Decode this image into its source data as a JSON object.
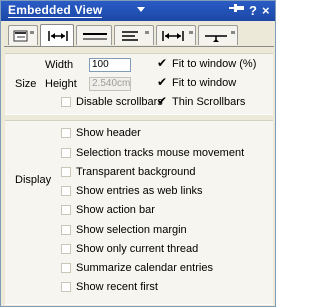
{
  "window": {
    "title": "Embedded View",
    "pin_icon": "pin-icon",
    "help_label": "?",
    "close_label": "×"
  },
  "tabs": [
    {
      "name": "basics",
      "icon": "properties-icon"
    },
    {
      "name": "width",
      "icon": "width-arrows-icon",
      "selected": true
    },
    {
      "name": "border",
      "icon": "border-lines-icon"
    },
    {
      "name": "text",
      "icon": "paragraph-icon"
    },
    {
      "name": "size",
      "icon": "stretch-icon"
    },
    {
      "name": "margin",
      "icon": "margin-icon"
    }
  ],
  "size_section": {
    "label": "Size",
    "width_label": "Width",
    "width_value": "100",
    "height_label": "Height",
    "height_value": "2.540cm",
    "options": [
      {
        "label": "Fit to window (%)",
        "checked": true
      },
      {
        "label": "Fit to window",
        "checked": true
      },
      {
        "label": "Disable scrollbars",
        "checked": false
      },
      {
        "label": "Thin Scrollbars",
        "checked": true
      }
    ]
  },
  "display_section": {
    "label": "Display",
    "options": [
      {
        "label": "Show header",
        "checked": false
      },
      {
        "label": "Selection tracks mouse movement",
        "checked": false
      },
      {
        "label": "Transparent background",
        "checked": false
      },
      {
        "label": "Show entries as web links",
        "checked": false
      },
      {
        "label": "Show action bar",
        "checked": false
      },
      {
        "label": "Show selection margin",
        "checked": false
      },
      {
        "label": "Show only current thread",
        "checked": false
      },
      {
        "label": "Summarize calendar entries",
        "checked": false
      },
      {
        "label": "Show recent first",
        "checked": false
      }
    ]
  },
  "colors": {
    "titlebar": "#1c47a6",
    "panel": "#ece9d8",
    "section": "#f6f5ef"
  }
}
